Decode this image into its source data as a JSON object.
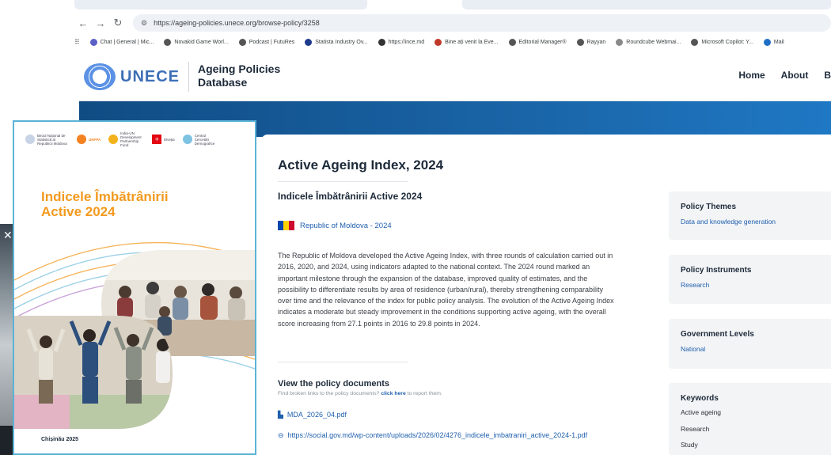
{
  "browser": {
    "url": "https://ageing-policies.unece.org/browse-policy/3258",
    "bookmarks": [
      {
        "label": "Chat | General | Mic...",
        "color": "#5b5fc7"
      },
      {
        "label": "Novakid Game Worl...",
        "color": "#555555"
      },
      {
        "label": "Podcast | FutuRes",
        "color": "#555555"
      },
      {
        "label": "Statista Industry Ov...",
        "color": "#1e3a8a"
      },
      {
        "label": "https://ince.md",
        "color": "#333333"
      },
      {
        "label": "Bine ați venit la Eve...",
        "color": "#c0392b"
      },
      {
        "label": "Editorial Manager®",
        "color": "#555555"
      },
      {
        "label": "Rayyan",
        "color": "#555555"
      },
      {
        "label": "Roundcube Webmai...",
        "color": "#8a8a8a"
      },
      {
        "label": "Microsoft Copilot: Y...",
        "color": "#555555"
      },
      {
        "label": "Mail",
        "color": "#1f6fc5"
      }
    ]
  },
  "header": {
    "logo_text": "UNECE",
    "db_title": "Ageing Policies Database",
    "nav": [
      "Home",
      "About",
      "B"
    ]
  },
  "policy": {
    "title": "Active Ageing Index, 2024",
    "subtitle": "Indicele Îmbătrânirii Active 2024",
    "country_year": "Republic of Moldova - 2024",
    "flag_colors": [
      "#0046ae",
      "#ffd200",
      "#cc092f"
    ],
    "description": "The Republic of Moldova developed the Active Ageing Index, with three rounds of calculation carried out in 2016, 2020, and 2024, using indicators adapted to the national context. The 2024 round marked an important milestone through the expansion of the database, improved quality of estimates, and the possibility to differentiate results by area of residence (urban/rural), thereby strengthening comparability over time and the relevance of the index for public policy analysis. The evolution of the Active Ageing Index indicates a moderate but steady improvement in the conditions supporting active ageing, with the overall score increasing from 27.1 points in 2016 to 29.8 points in 2024."
  },
  "documents": {
    "title": "View the policy documents",
    "note_prefix": "Find broken links to the policy documents?",
    "note_link": "click here",
    "note_suffix": "to report them.",
    "pdf_label": "MDA_2026_04.pdf",
    "url_label": "https://social.gov.md/wp-content/uploads/2026/02/4276_indicele_imbatraniri_active_2024-1.pdf"
  },
  "sidebar": {
    "themes": {
      "title": "Policy Themes",
      "value": "Data and knowledge generation"
    },
    "instruments": {
      "title": "Policy Instruments",
      "value": "Research"
    },
    "levels": {
      "title": "Government Levels",
      "value": "National"
    },
    "keywords": {
      "title": "Keywords",
      "items": [
        "Active ageing",
        "Research",
        "Study"
      ]
    }
  },
  "cover": {
    "title": "Indicele Îmbătrânirii Active 2024",
    "footer": "Chișinău 2025",
    "partner_labels": [
      "Biroul Național de Statistică al Republicii Moldova",
      "UNFPA",
      "India-UN Development Partnership Fund",
      "Elveția",
      "Centrul Cercetări Demografice"
    ]
  },
  "colors": {
    "link": "#1f5fae",
    "hero": "#104c84",
    "cover_accent": "#f39a1f",
    "cover_border": "#5ab3d6"
  }
}
